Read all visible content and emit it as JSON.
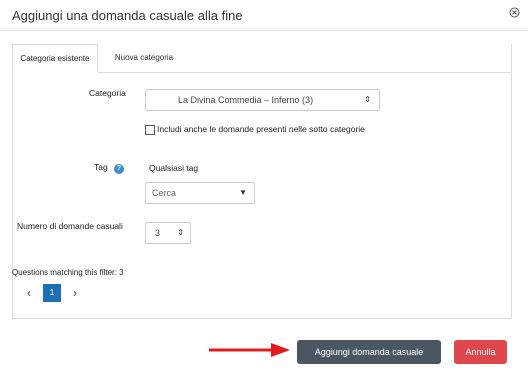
{
  "dialog": {
    "title": "Aggiungi una domanda casuale alla fine"
  },
  "tabs": [
    {
      "label": "Categoria esistente",
      "active": true
    },
    {
      "label": "Nuova categoria",
      "active": false
    }
  ],
  "form": {
    "category_label": "Categoria",
    "category_value": "La Divina Commedia – Inferno (3)",
    "subcategory_checkbox_label": "Includi anche le domande presenti nelle sotto categorie",
    "subcategory_checked": false,
    "tag_label": "Tag",
    "tag_value_text": "Qualsiasi tag",
    "tag_search_placeholder": "Cerca",
    "count_label": "Numero di domande casuali",
    "count_value": "3",
    "matching_text": "Questions matching this filter: 3"
  },
  "pager": {
    "prev": "‹",
    "current": "1",
    "next": "›"
  },
  "buttons": {
    "add": "Aggiungi domanda casuale",
    "cancel": "Annulla"
  },
  "colors": {
    "primary_dark": "#4b5760",
    "danger": "#e0474c",
    "pager_active": "#1f6fb5",
    "arrow": "#e21b1b",
    "help": "#3c8dcf"
  }
}
